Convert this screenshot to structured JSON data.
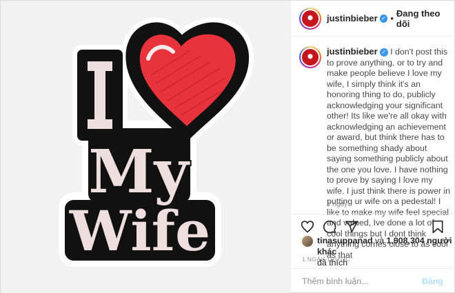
{
  "post": {
    "author": "justinbieber",
    "verified_icon": "verified-badge-icon",
    "follow_state": "Đang theo dõi",
    "separator": "•"
  },
  "image": {
    "words": [
      "I",
      "My",
      "Wife"
    ],
    "heart_icon": "heart-icon",
    "colors": {
      "background": "#f2f2f2",
      "letters": "#efdede",
      "outline": "#111111",
      "heart": "#e8323c"
    }
  },
  "caption": {
    "username": "justinbieber",
    "text": "I don't post this to prove anything, or to try and make people believe I love my wife, I simply think it's an honoring thing to do, publicly acknowledging your significant other! Its like we're all okay with acknowledging an achievement or award, but think there has to be something shady about saying something publicly about the one you love. I have nothing to prove by saying I love my wife. I just think there is power in putting ur wife on a pedestal! I like to make my wife feel special and valued, Ive done a lot of cool things but I dont think anything comes close to as cool as that",
    "time": "1 ngày"
  },
  "actions": {
    "icons": [
      "heart-outline-icon",
      "comment-icon",
      "share-icon",
      "bookmark-icon"
    ]
  },
  "likes": {
    "liker": "tinasuppanad",
    "connector": "và",
    "count": "1,908,304 người khác",
    "suffix": "đã thích"
  },
  "timestamp": "1 NGÀY TRƯỚC",
  "comment": {
    "placeholder": "Thêm bình luận...",
    "emoji_icon": "emoji-icon",
    "post_label": "Đăng"
  }
}
